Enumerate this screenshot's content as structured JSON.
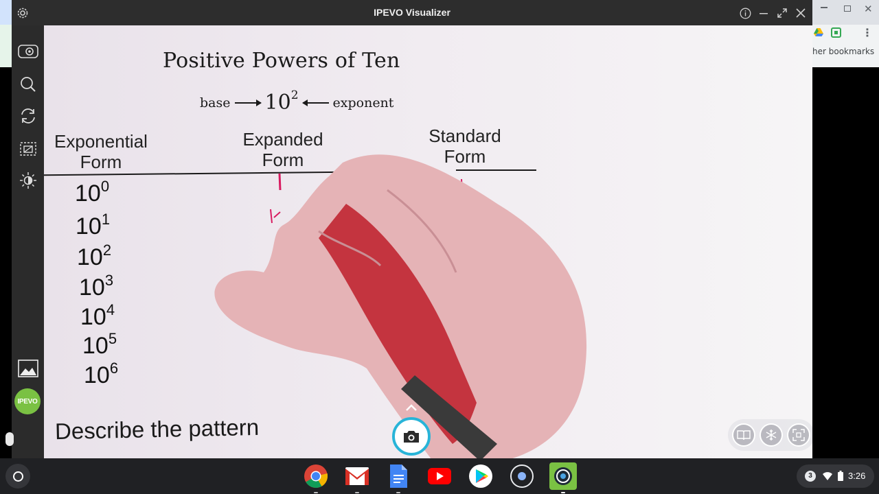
{
  "window": {
    "title": "IPEVO Visualizer"
  },
  "background_browser": {
    "bookmarks_partial": "her bookmarks"
  },
  "sidebar": {
    "items": [
      {
        "name": "view-mode-icon"
      },
      {
        "name": "zoom-icon"
      },
      {
        "name": "rotate-icon"
      },
      {
        "name": "crop-icon"
      },
      {
        "name": "brightness-icon"
      },
      {
        "name": "gallery-icon"
      }
    ],
    "logo_text": "IPEVO"
  },
  "document": {
    "title": "Positive Powers of Ten",
    "base_label": "base",
    "base_number": "10",
    "base_exponent": "2",
    "exponent_label": "exponent",
    "columns": [
      {
        "line1": "Exponential",
        "line2": "Form"
      },
      {
        "line1": "Expanded",
        "line2": "Form"
      },
      {
        "line1": "Standard",
        "line2": "Form"
      }
    ],
    "rows": [
      {
        "base": "10",
        "exp": "0"
      },
      {
        "base": "10",
        "exp": "1"
      },
      {
        "base": "10",
        "exp": "2"
      },
      {
        "base": "10",
        "exp": "3"
      },
      {
        "base": "10",
        "exp": "4"
      },
      {
        "base": "10",
        "exp": "5"
      },
      {
        "base": "10",
        "exp": "6"
      }
    ],
    "prompt": "Describe the pattern"
  },
  "controls": {
    "capture_icon": "camera-icon",
    "overlay": [
      "book-mode-icon",
      "freeze-icon",
      "fullscreen-icon"
    ]
  },
  "shelf": {
    "apps": [
      "chrome-icon",
      "gmail-icon",
      "docs-icon",
      "youtube-icon",
      "play-store-icon",
      "camera-app-icon",
      "ipevo-app-icon"
    ],
    "notification_count": "3",
    "time": "3:26"
  },
  "colors": {
    "capture_ring": "#28b4d8",
    "ipevo_green": "#7ac143",
    "ink": "#d81b60"
  }
}
